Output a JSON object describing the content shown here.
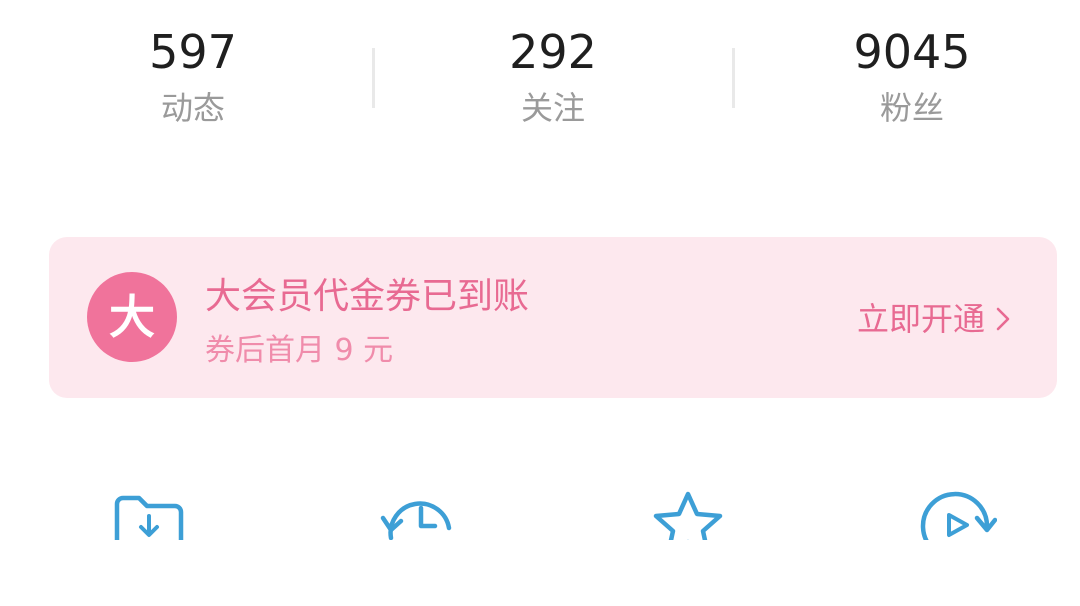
{
  "stats": [
    {
      "value": "597",
      "label": "动态"
    },
    {
      "value": "292",
      "label": "关注"
    },
    {
      "value": "9045",
      "label": "粉丝"
    }
  ],
  "vip_banner": {
    "badge": "大",
    "title": "大会员代金券已到账",
    "subtitle": "券后首月 9 元",
    "action_label": "立即开通"
  },
  "shortcuts": [
    {
      "icon": "download-folder-icon"
    },
    {
      "icon": "history-clock-icon"
    },
    {
      "icon": "star-icon"
    },
    {
      "icon": "watch-later-play-icon"
    }
  ],
  "colors": {
    "accent_pink": "#e86a92",
    "banner_bg": "#fde8ee",
    "badge_pink": "#f0739b",
    "icon_blue": "#3d9fd6",
    "stat_label": "#9a9a9a"
  }
}
